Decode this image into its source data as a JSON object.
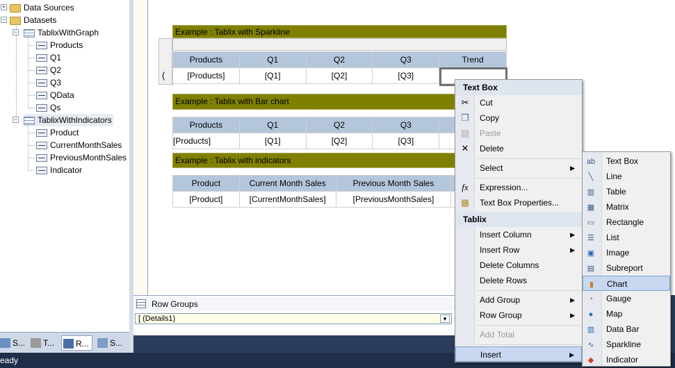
{
  "tree": {
    "data_sources": "Data Sources",
    "datasets": "Datasets",
    "ds1": "TablixWithGraph",
    "ds1_fields": [
      "Products",
      "Q1",
      "Q2",
      "Q3",
      "QData",
      "Qs"
    ],
    "ds2": "TablixWithIndicators",
    "ds2_fields": [
      "Product",
      "CurrentMonthSales",
      "PreviousMonthSales",
      "Indicator"
    ]
  },
  "left_tabs": [
    "S...",
    "T...",
    "R...",
    "S..."
  ],
  "status": "eady",
  "report": {
    "t1_title": "Example : Tablix with Sparkline",
    "t1_headers": [
      "Products",
      "Q1",
      "Q2",
      "Q3",
      "Trend"
    ],
    "t1_row": [
      "[Products]",
      "[Q1]",
      "[Q2]",
      "[Q3]",
      ""
    ],
    "t1_rowmarker": "(",
    "t2_title": "Example : Tablix with Bar chart",
    "t2_headers": [
      "Products",
      "Q1",
      "Q2",
      "Q3",
      ""
    ],
    "t2_row": [
      "[Products]",
      "[Q1]",
      "[Q2]",
      "[Q3]",
      ""
    ],
    "t3_title": "Example : Tablix with indicators",
    "t3_headers": [
      "Product",
      "Current Month Sales",
      "Previous Month Sales",
      ""
    ],
    "t3_row": [
      "[Product]",
      "[CurrentMonthSales]",
      "[PreviousMonthSales]",
      ""
    ]
  },
  "row_groups": {
    "title": "Row Groups",
    "value": "[ (Details1)"
  },
  "context_menu": {
    "sec1": "Text Box",
    "cut": "Cut",
    "copy": "Copy",
    "paste": "Paste",
    "delete": "Delete",
    "select": "Select",
    "expression": "Expression...",
    "tb_props": "Text Box Properties...",
    "sec2": "Tablix",
    "insert_column": "Insert Column",
    "insert_row": "Insert Row",
    "delete_columns": "Delete Columns",
    "delete_rows": "Delete Rows",
    "add_group": "Add Group",
    "row_group": "Row Group",
    "add_total": "Add Total",
    "insert": "Insert"
  },
  "insert_menu": [
    "Text Box",
    "Line",
    "Table",
    "Matrix",
    "Rectangle",
    "List",
    "Image",
    "Subreport",
    "Chart",
    "Gauge",
    "Map",
    "Data Bar",
    "Sparkline",
    "Indicator"
  ],
  "highlighted_item": "Chart",
  "colors": {
    "title_bar": "#808000",
    "header_cell": "#b4c6dc",
    "menu_highlight": "#c8d8f0"
  }
}
